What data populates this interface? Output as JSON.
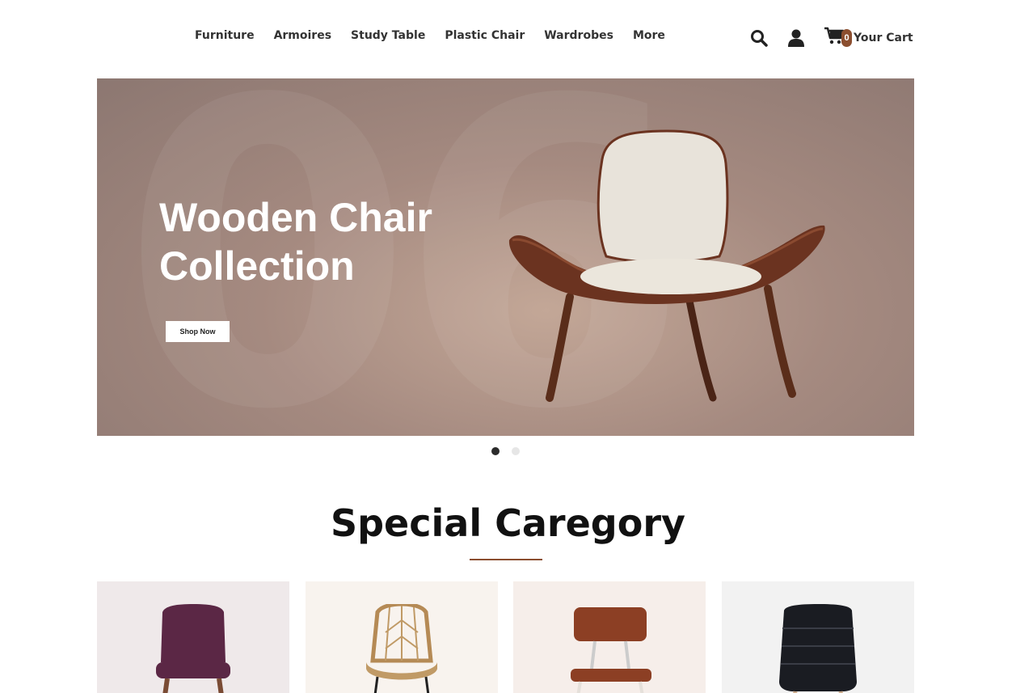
{
  "header": {
    "nav": [
      "Furniture",
      "Armoires",
      "Study Table",
      "Plastic Chair",
      "Wardrobes",
      "More"
    ],
    "icons": [
      "search-icon",
      "user-icon",
      "cart-icon"
    ],
    "cart": {
      "count": "0",
      "label": "Your Cart"
    }
  },
  "hero": {
    "title_line1": "Wooden Chair",
    "title_line2": "Collection",
    "button": "Shop Now",
    "background_number": "06",
    "slide_count": 2,
    "active_slide": 1
  },
  "section": {
    "title": "Special Caregory"
  },
  "categories": [
    {
      "chair": "purple-upholstered-chair",
      "bg": "#efe9ea"
    },
    {
      "chair": "rattan-chair",
      "bg": "#f8f3ee"
    },
    {
      "chair": "brown-leather-chair",
      "bg": "#f6eeea"
    },
    {
      "chair": "black-leather-chair",
      "bg": "#f2f2f2"
    }
  ],
  "colors": {
    "accent": "#8b4e2f",
    "text_dark": "#111111"
  }
}
